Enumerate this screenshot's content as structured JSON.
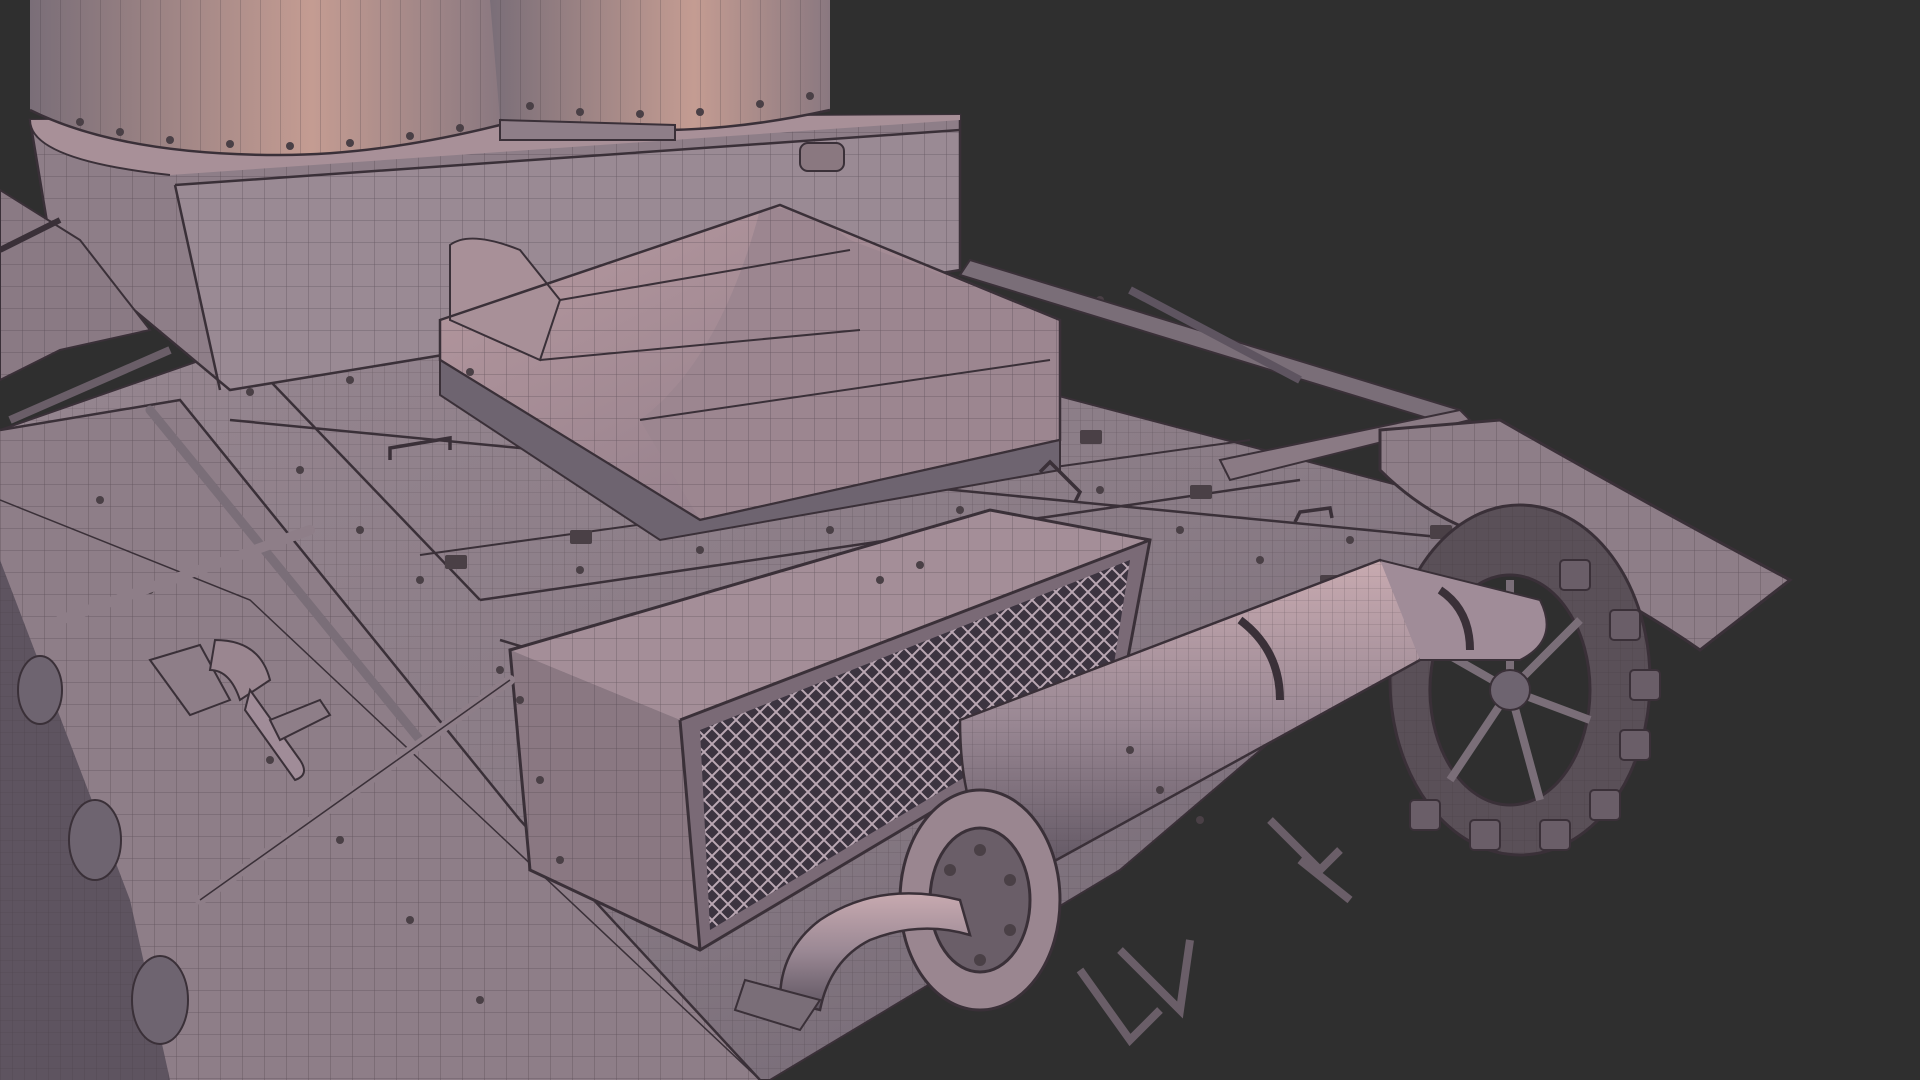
{
  "viewport": {
    "background": "#2f2f2f",
    "subject": "tank-rear-deck-wireframe-render"
  },
  "materials": {
    "shell": "#7a7078",
    "shell_light": "#a08c98",
    "shell_warm": "#b8968c",
    "shell_dark": "#5a5058",
    "wire": "#3a3038",
    "bolt": "#4a4046"
  },
  "icons": {
    "turret_dome_left": "turret-dome-icon",
    "turret_dome_right": "turret-dome-icon",
    "exhaust_muffler": "muffler-icon",
    "air_intake_grille": "grille-icon",
    "drive_sprocket": "sprocket-icon",
    "axe_tool": "axe-icon",
    "track_fender": "fender-icon"
  }
}
